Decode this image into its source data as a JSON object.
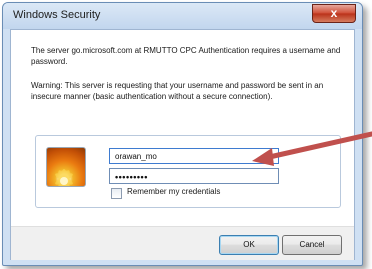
{
  "window": {
    "title": "Windows Security",
    "close_label": "x"
  },
  "message": {
    "line1": "The server go.microsoft.com at RMUTTO CPC Authentication  requires a username and password.",
    "warning": "Warning: This server is requesting that your username and password be sent in an insecure manner (basic authentication without a secure connection)."
  },
  "credentials": {
    "username_value": "orawan_mo",
    "password_mask": "•••••••••",
    "remember_label": "Remember my credentials",
    "remember_checked": false,
    "avatar_icon": "flower-icon"
  },
  "buttons": {
    "ok_label": "OK",
    "cancel_label": "Cancel"
  },
  "annotation": {
    "arrow_color": "#c0504d"
  }
}
